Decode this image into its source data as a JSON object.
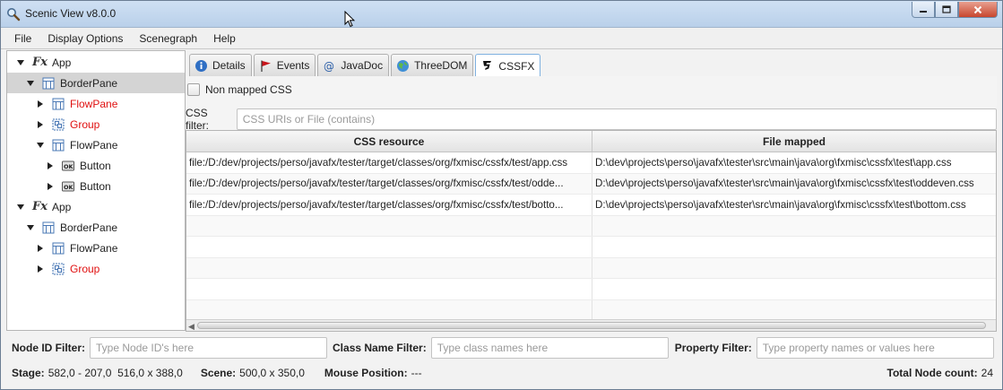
{
  "window": {
    "title": "Scenic View v8.0.0"
  },
  "menu": [
    "File",
    "Display Options",
    "Scenegraph",
    "Help"
  ],
  "tree": [
    {
      "label": "App",
      "level": 0,
      "expanded": true,
      "kind": "fx"
    },
    {
      "label": "BorderPane",
      "level": 1,
      "expanded": true,
      "kind": "pane",
      "selected": true
    },
    {
      "label": "FlowPane",
      "level": 2,
      "expanded": false,
      "kind": "pane",
      "red": true
    },
    {
      "label": "Group",
      "level": 2,
      "expanded": false,
      "kind": "group",
      "red": true
    },
    {
      "label": "FlowPane",
      "level": 2,
      "expanded": true,
      "kind": "pane"
    },
    {
      "label": "Button",
      "level": 3,
      "expanded": false,
      "kind": "button"
    },
    {
      "label": "Button",
      "level": 3,
      "expanded": false,
      "kind": "button"
    },
    {
      "label": "App",
      "level": 0,
      "expanded": true,
      "kind": "fx"
    },
    {
      "label": "BorderPane",
      "level": 1,
      "expanded": true,
      "kind": "pane"
    },
    {
      "label": "FlowPane",
      "level": 2,
      "expanded": false,
      "kind": "pane"
    },
    {
      "label": "Group",
      "level": 2,
      "expanded": false,
      "kind": "group",
      "red": true
    }
  ],
  "tabs": [
    {
      "label": "Details",
      "icon": "info-icon"
    },
    {
      "label": "Events",
      "icon": "flag-icon"
    },
    {
      "label": "JavaDoc",
      "icon": "at-icon"
    },
    {
      "label": "ThreeDOM",
      "icon": "globe-icon"
    },
    {
      "label": "CSSFX",
      "icon": "css3-icon",
      "active": true
    }
  ],
  "cssfx": {
    "non_mapped_label": "Non mapped CSS",
    "filter_label": "CSS filter:",
    "filter_placeholder": "CSS URIs or File (contains)",
    "columns": [
      "CSS resource",
      "File mapped"
    ],
    "rows": [
      [
        "file:/D:/dev/projects/perso/javafx/tester/target/classes/org/fxmisc/cssfx/test/app.css",
        "D:\\dev\\projects\\perso\\javafx\\tester\\src\\main\\java\\org\\fxmisc\\cssfx\\test\\app.css"
      ],
      [
        "file:/D:/dev/projects/perso/javafx/tester/target/classes/org/fxmisc/cssfx/test/odde...",
        "D:\\dev\\projects\\perso\\javafx\\tester\\src\\main\\java\\org\\fxmisc\\cssfx\\test\\oddeven.css"
      ],
      [
        "file:/D:/dev/projects/perso/javafx/tester/target/classes/org/fxmisc/cssfx/test/botto...",
        "D:\\dev\\projects\\perso\\javafx\\tester\\src\\main\\java\\org\\fxmisc\\cssfx\\test\\bottom.css"
      ]
    ],
    "empty_rows": 5
  },
  "filters": {
    "node_id_label": "Node ID Filter:",
    "node_id_placeholder": "Type Node ID's here",
    "class_label": "Class Name Filter:",
    "class_placeholder": "Type class names here",
    "property_label": "Property Filter:",
    "property_placeholder": "Type property names or values here"
  },
  "status": {
    "stage_label": "Stage:",
    "stage_value": "582,0 - 207,0  516,0 x 388,0",
    "scene_label": "Scene:",
    "scene_value": "500,0 x 350,0",
    "mouse_label": "Mouse Position:",
    "mouse_value": "---",
    "total_label": "Total Node count:",
    "total_value": "24"
  }
}
